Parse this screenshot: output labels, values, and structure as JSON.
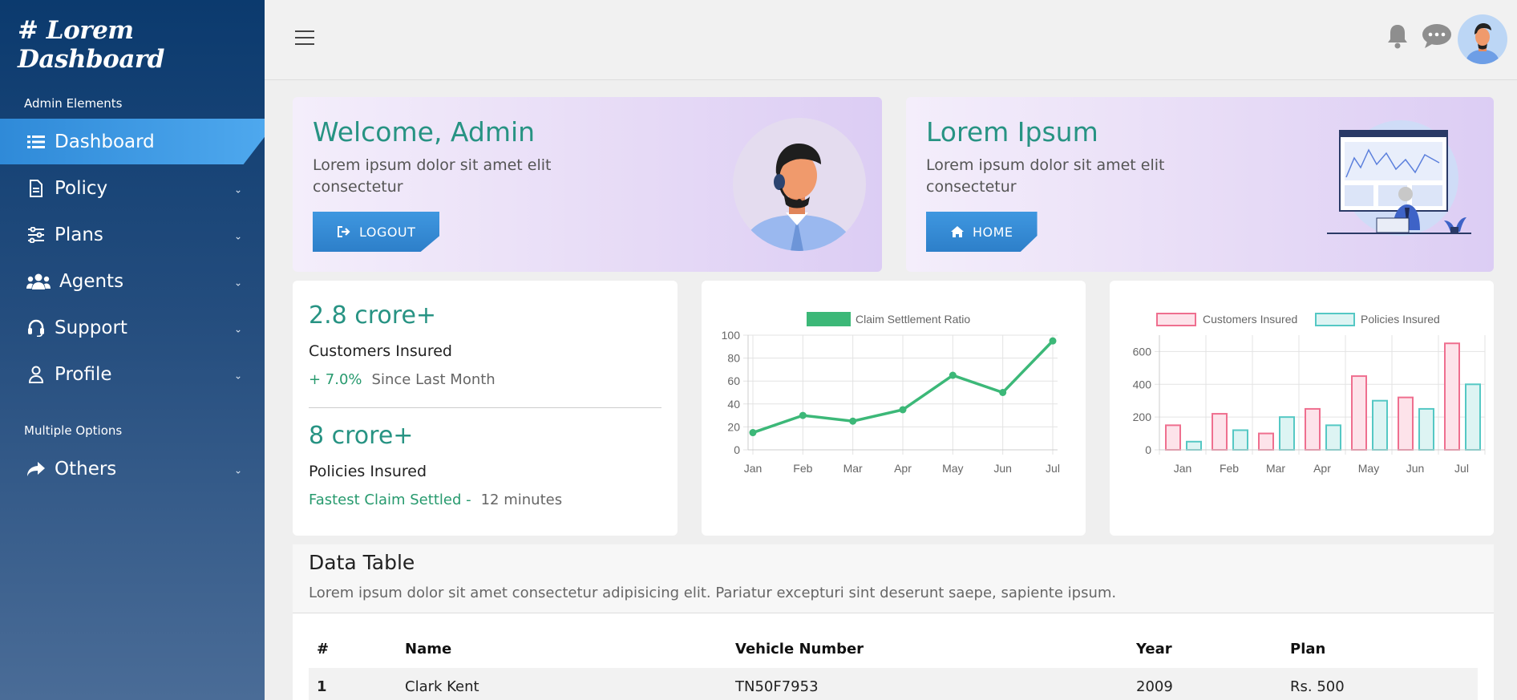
{
  "brand": "# Lorem Dashboard",
  "sidebar": {
    "section1": "Admin Elements",
    "section2": "Multiple Options",
    "items": [
      {
        "label": "Dashboard"
      },
      {
        "label": "Policy"
      },
      {
        "label": "Plans"
      },
      {
        "label": "Agents"
      },
      {
        "label": "Support"
      },
      {
        "label": "Profile"
      },
      {
        "label": "Others"
      }
    ]
  },
  "hero": [
    {
      "title": "Welcome, Admin",
      "desc": "Lorem ipsum dolor sit amet elit consectetur",
      "button": "LOGOUT"
    },
    {
      "title": "Lorem Ipsum",
      "desc": "Lorem ipsum dolor sit amet elit consectetur",
      "button": "HOME"
    }
  ],
  "stats": {
    "customers_value": "2.8 crore+",
    "customers_label": "Customers Insured",
    "customers_change": "+ 7.0%",
    "customers_since": "Since Last Month",
    "policies_value": "8 crore+",
    "policies_label": "Policies Insured",
    "fastest_label": "Fastest Claim Settled -",
    "fastest_value": "12 minutes"
  },
  "colors": {
    "accent_teal": "#279383",
    "line_green": "#3cb878",
    "bar_pink": "#ef6f8f",
    "bar_teal": "#55c8c4"
  },
  "chart_data": [
    {
      "type": "line",
      "categories": [
        "Jan",
        "Feb",
        "Mar",
        "Apr",
        "May",
        "Jun",
        "Jul"
      ],
      "series": [
        {
          "name": "Claim Settlement Ratio",
          "values": [
            15,
            30,
            25,
            35,
            65,
            50,
            95
          ]
        }
      ],
      "ylim": [
        0,
        100
      ],
      "yticks": [
        0,
        20,
        40,
        60,
        80,
        100
      ],
      "grid": true,
      "legend": "top"
    },
    {
      "type": "bar",
      "categories": [
        "Jan",
        "Feb",
        "Mar",
        "Apr",
        "May",
        "Jun",
        "Jul"
      ],
      "series": [
        {
          "name": "Customers Insured",
          "values": [
            150,
            220,
            100,
            250,
            450,
            320,
            650
          ]
        },
        {
          "name": "Policies Insured",
          "values": [
            50,
            120,
            200,
            150,
            300,
            250,
            400
          ]
        }
      ],
      "ylim": [
        0,
        700
      ],
      "yticks": [
        0,
        200,
        400,
        600
      ],
      "grid": true,
      "legend": "top"
    }
  ],
  "table": {
    "title": "Data Table",
    "desc": "Lorem ipsum dolor sit amet consectetur adipisicing elit. Pariatur excepturi sint deserunt saepe, sapiente ipsum.",
    "headers": [
      "#",
      "Name",
      "Vehicle Number",
      "Year",
      "Plan"
    ],
    "rows": [
      [
        "1",
        "Clark Kent",
        "TN50F7953",
        "2009",
        "Rs. 500"
      ]
    ]
  }
}
